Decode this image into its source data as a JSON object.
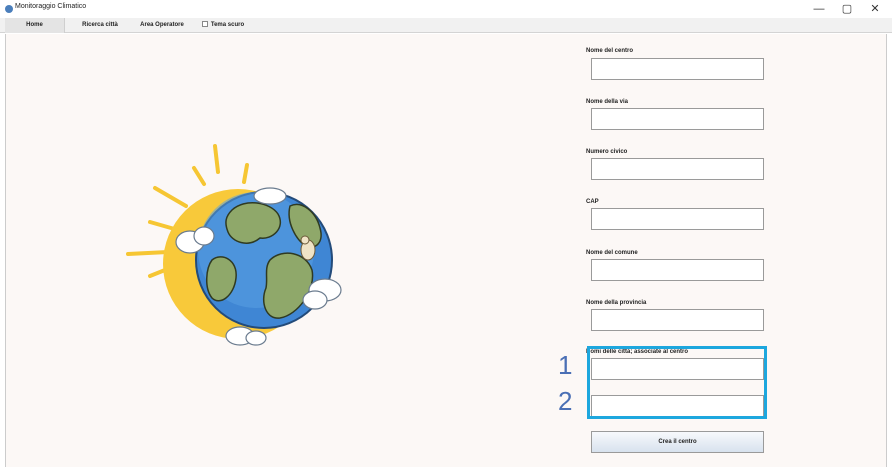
{
  "window": {
    "title": "Monitoraggio Climatico",
    "controls": {
      "minimize": "—",
      "maximize": "▢",
      "close": "✕"
    }
  },
  "menu": {
    "home": "Home",
    "ricerca": "Ricerca città",
    "area_operatore": "Area Operatore",
    "tema_scuro": "Tema scuro"
  },
  "illustration": {
    "icon": "earth-globe-sun-illustration"
  },
  "form": {
    "fields": [
      {
        "label": "Nome del centro",
        "value": ""
      },
      {
        "label": "Nome della via",
        "value": ""
      },
      {
        "label": "Numero civico",
        "value": ""
      },
      {
        "label": "CAP",
        "value": ""
      },
      {
        "label": "Nome del comune",
        "value": ""
      },
      {
        "label": "Nome della provincia",
        "value": ""
      }
    ],
    "cities_label": "Nomi delle città; associate al centro",
    "city_inputs": [
      "",
      ""
    ],
    "submit_label": "Crea il centro"
  },
  "annotations": {
    "marker_1": "1",
    "marker_2": "2",
    "highlight_color": "#1da7de",
    "marker_color": "#4a6fb5"
  }
}
